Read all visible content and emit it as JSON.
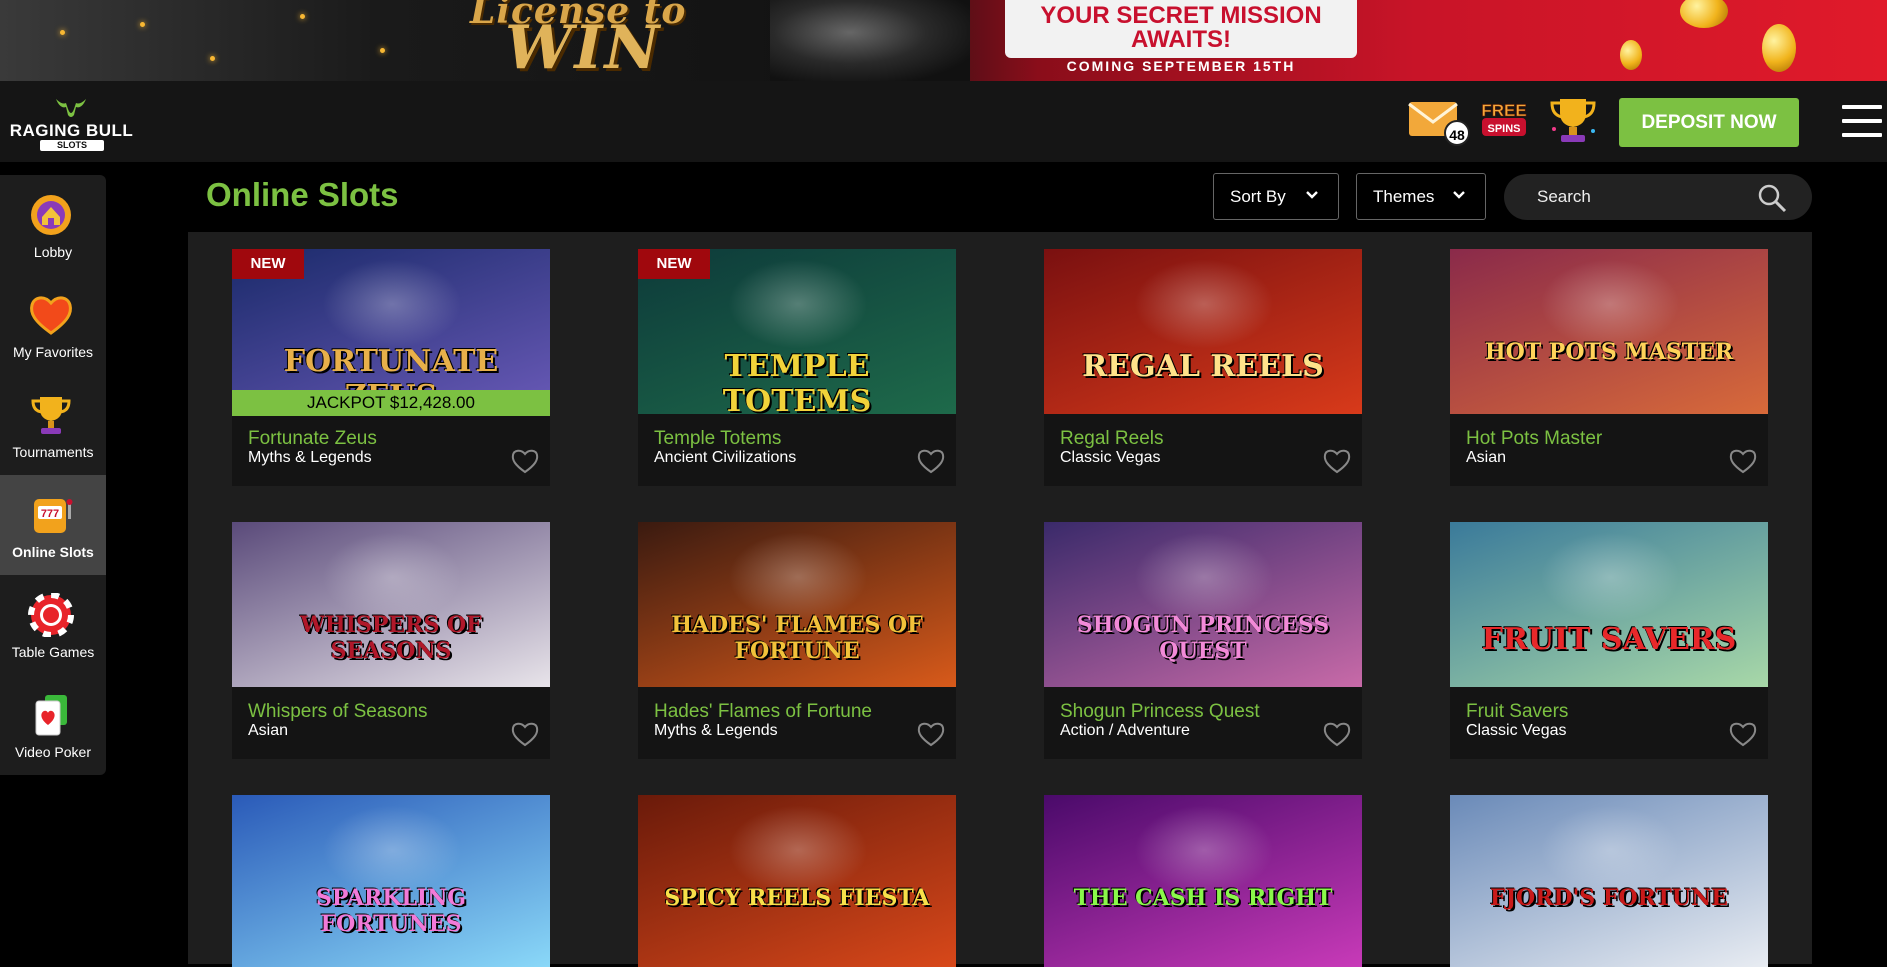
{
  "banner": {
    "title_line1": "License to",
    "title_line2": "WIN",
    "mission": "YOUR SECRET MISSION AWAITS!",
    "coming": "COMING SEPTEMBER 15TH"
  },
  "header": {
    "brand": "RAGING BULL",
    "brand_sub": "SLOTS",
    "mail_count": "48",
    "free_spins_line1": "FREE",
    "free_spins_line2": "SPINS",
    "deposit_label": "DEPOSIT NOW"
  },
  "sidebar": {
    "items": [
      {
        "label": "Lobby",
        "icon": "lobby-icon"
      },
      {
        "label": "My Favorites",
        "icon": "heart-icon"
      },
      {
        "label": "Tournaments",
        "icon": "trophy-icon"
      },
      {
        "label": "Online Slots",
        "icon": "slot-machine-icon",
        "active": true
      },
      {
        "label": "Table Games",
        "icon": "poker-chip-icon"
      },
      {
        "label": "Video Poker",
        "icon": "playing-card-icon"
      }
    ]
  },
  "main": {
    "title": "Online Slots",
    "sort_label": "Sort By",
    "themes_label": "Themes",
    "search_placeholder": "Search"
  },
  "games": [
    {
      "name": "Fortunate Zeus",
      "theme": "Myths & Legends",
      "badge": "NEW",
      "jackpot": "JACKPOT $12,428.00",
      "art_title": "FORTUNATE ZEUS",
      "bg": [
        "#1a2a6a",
        "#6a5ab8"
      ],
      "color": "#e8b04a"
    },
    {
      "name": "Temple Totems",
      "theme": "Ancient Civilizations",
      "badge": "NEW",
      "art_title": "TEMPLE TOTEMS",
      "bg": [
        "#0d3a3a",
        "#1e6a4a"
      ],
      "color": "#f2d33a"
    },
    {
      "name": "Regal Reels",
      "theme": "Classic Vegas",
      "art_title": "REGAL REELS",
      "bg": [
        "#7a1010",
        "#d83a1a"
      ],
      "color": "#ffe28a"
    },
    {
      "name": "Hot Pots Master",
      "theme": "Asian",
      "art_title": "HOT POTS MASTER",
      "bg": [
        "#8a2a4a",
        "#d86a3a"
      ],
      "color": "#ffd35a"
    },
    {
      "name": "Whispers of Seasons",
      "theme": "Asian",
      "art_title": "WHISPERS OF SEASONS",
      "bg": [
        "#5a4a7a",
        "#e8e4ea"
      ],
      "color": "#b0182a"
    },
    {
      "name": "Hades' Flames of Fortune",
      "theme": "Myths & Legends",
      "art_title": "HADES' FLAMES OF FORTUNE",
      "bg": [
        "#3a1a10",
        "#d85a1a"
      ],
      "color": "#f2c23a"
    },
    {
      "name": "Shogun Princess Quest",
      "theme": "Action / Adventure",
      "art_title": "SHOGUN PRINCESS QUEST",
      "bg": [
        "#3a2a6a",
        "#c86aa8"
      ],
      "color": "#f28ad8"
    },
    {
      "name": "Fruit Savers",
      "theme": "Classic Vegas",
      "art_title": "FRUIT SAVERS",
      "bg": [
        "#3a7a9a",
        "#a8d8a8"
      ],
      "color": "#e8282a"
    },
    {
      "name": "Sparkling Fortunes",
      "theme": "",
      "art_title": "SPARKLING FORTUNES",
      "bg": [
        "#2a5ab8",
        "#8ad8f8"
      ],
      "color": "#f27ad8"
    },
    {
      "name": "Spicy Reels Fiesta",
      "theme": "",
      "art_title": "SPICY REELS FIESTA",
      "bg": [
        "#6a1a0a",
        "#d8481a"
      ],
      "color": "#f8e04a"
    },
    {
      "name": "The Cash is Right",
      "theme": "",
      "art_title": "THE CASH IS RIGHT",
      "bg": [
        "#4a0a6a",
        "#c83ab8"
      ],
      "color": "#8af84a"
    },
    {
      "name": "Fjord's Fortune",
      "theme": "",
      "art_title": "FJORD'S FORTUNE",
      "bg": [
        "#6a8ab8",
        "#e8ecf2"
      ],
      "color": "#c81a1a"
    }
  ]
}
